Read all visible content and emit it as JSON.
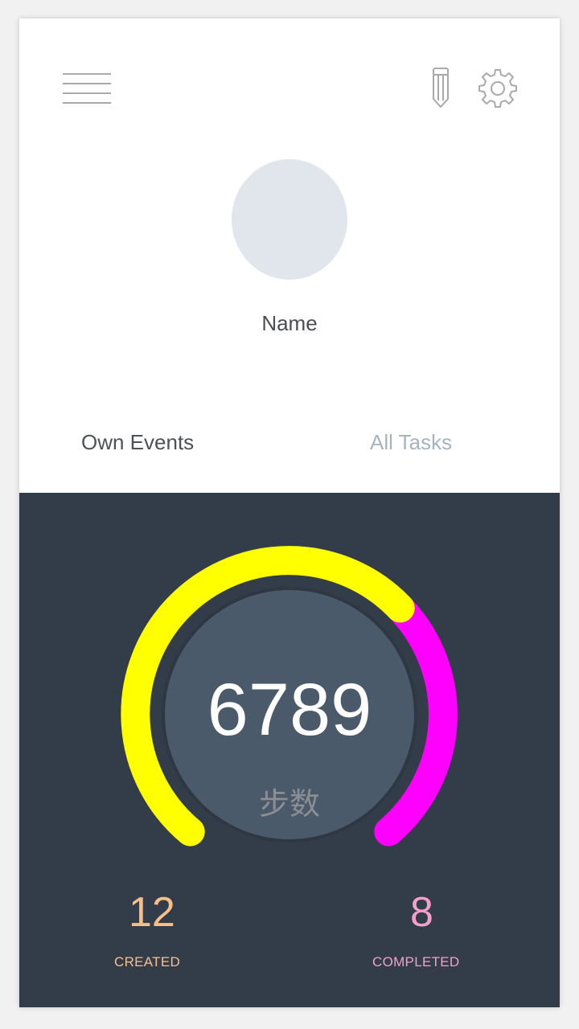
{
  "profile": {
    "name": "Name"
  },
  "tabs": [
    {
      "label": "Own Events",
      "active": true
    },
    {
      "label": "All Tasks",
      "active": false
    }
  ],
  "icons": {
    "menu": "menu-icon",
    "edit": "pencil-icon",
    "settings": "gear-icon"
  },
  "steps": {
    "value": "6789",
    "label": "步数"
  },
  "gauge": {
    "colors": {
      "primary": "#ffff00",
      "secondary": "#ff00ff",
      "inner": "#4a5a6a",
      "background": "#333d4a"
    }
  },
  "stats": {
    "created": {
      "value": "12",
      "label": "CREATED",
      "color": "#f7c08a"
    },
    "completed": {
      "value": "8",
      "label": "COMPLETED",
      "color": "#f59fcb"
    }
  }
}
